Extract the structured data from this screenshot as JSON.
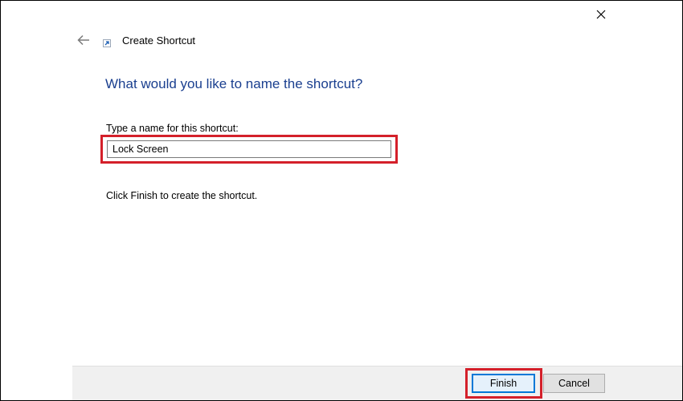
{
  "window": {
    "title": "Create Shortcut",
    "close_icon": "close-icon",
    "back_icon": "back-arrow-icon",
    "app_icon": "shortcut-icon"
  },
  "main": {
    "heading": "What would you like to name the shortcut?",
    "name_label": "Type a name for this shortcut:",
    "name_value": "Lock Screen",
    "hint": "Click Finish to create the shortcut."
  },
  "footer": {
    "finish_label": "Finish",
    "cancel_label": "Cancel"
  },
  "colors": {
    "heading": "#1a3f8f",
    "highlight": "#d4202a",
    "accent": "#0078d7"
  }
}
